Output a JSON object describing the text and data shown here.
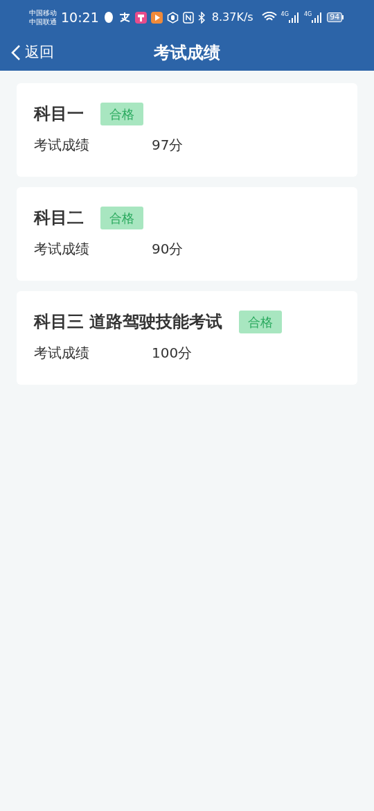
{
  "status_bar": {
    "carriers": [
      "中国移动",
      "中国联通"
    ],
    "time": "10:21",
    "speed": "8.37K/s",
    "network_labels": [
      "4G",
      "4G"
    ],
    "battery": "94"
  },
  "nav": {
    "back": "返回",
    "title": "考试成绩"
  },
  "results": [
    {
      "subject": "科目一",
      "badge": "合格",
      "label": "考试成绩",
      "score": "97分"
    },
    {
      "subject": "科目二",
      "badge": "合格",
      "label": "考试成绩",
      "score": "90分"
    },
    {
      "subject": "科目三 道路驾驶技能考试",
      "badge": "合格",
      "label": "考试成绩",
      "score": "100分"
    }
  ]
}
